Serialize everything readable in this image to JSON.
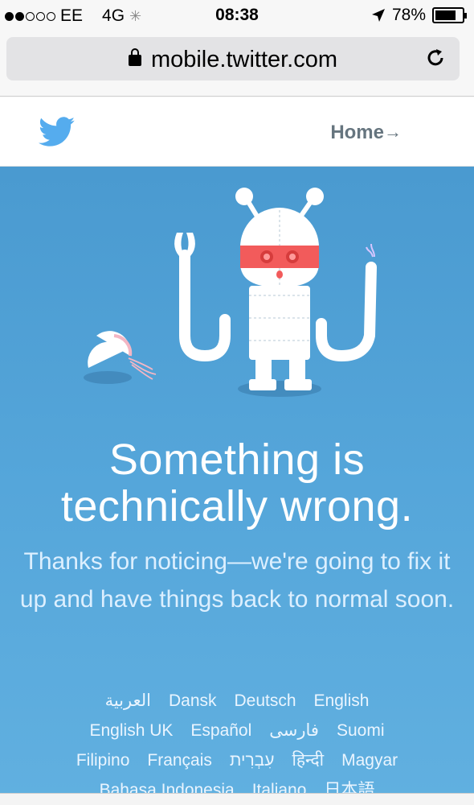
{
  "status_bar": {
    "carrier": "EE",
    "network": "4G",
    "time": "08:38",
    "battery": "78%",
    "battery_level": 0.78,
    "signal_bars_filled": 2,
    "signal_bars_total": 5
  },
  "browser": {
    "url": "mobile.twitter.com"
  },
  "header": {
    "home_label": "Home",
    "home_arrow": "→"
  },
  "error": {
    "headline": "Something is technically wrong.",
    "message": "Thanks for noticing—we're going to fix it up and have things back to normal soon."
  },
  "languages": [
    "العربية",
    "Dansk",
    "Deutsch",
    "English",
    "English UK",
    "Español",
    "فارسی",
    "Suomi",
    "Filipino",
    "Français",
    "עִבְרִית",
    "हिन्दी",
    "Magyar",
    "Bahasa Indonesia",
    "Italiano",
    "日本語"
  ],
  "colors": {
    "twitter_blue": "#55acee",
    "panel_blue": "#55a6da",
    "robot_band": "#f25b5b"
  }
}
